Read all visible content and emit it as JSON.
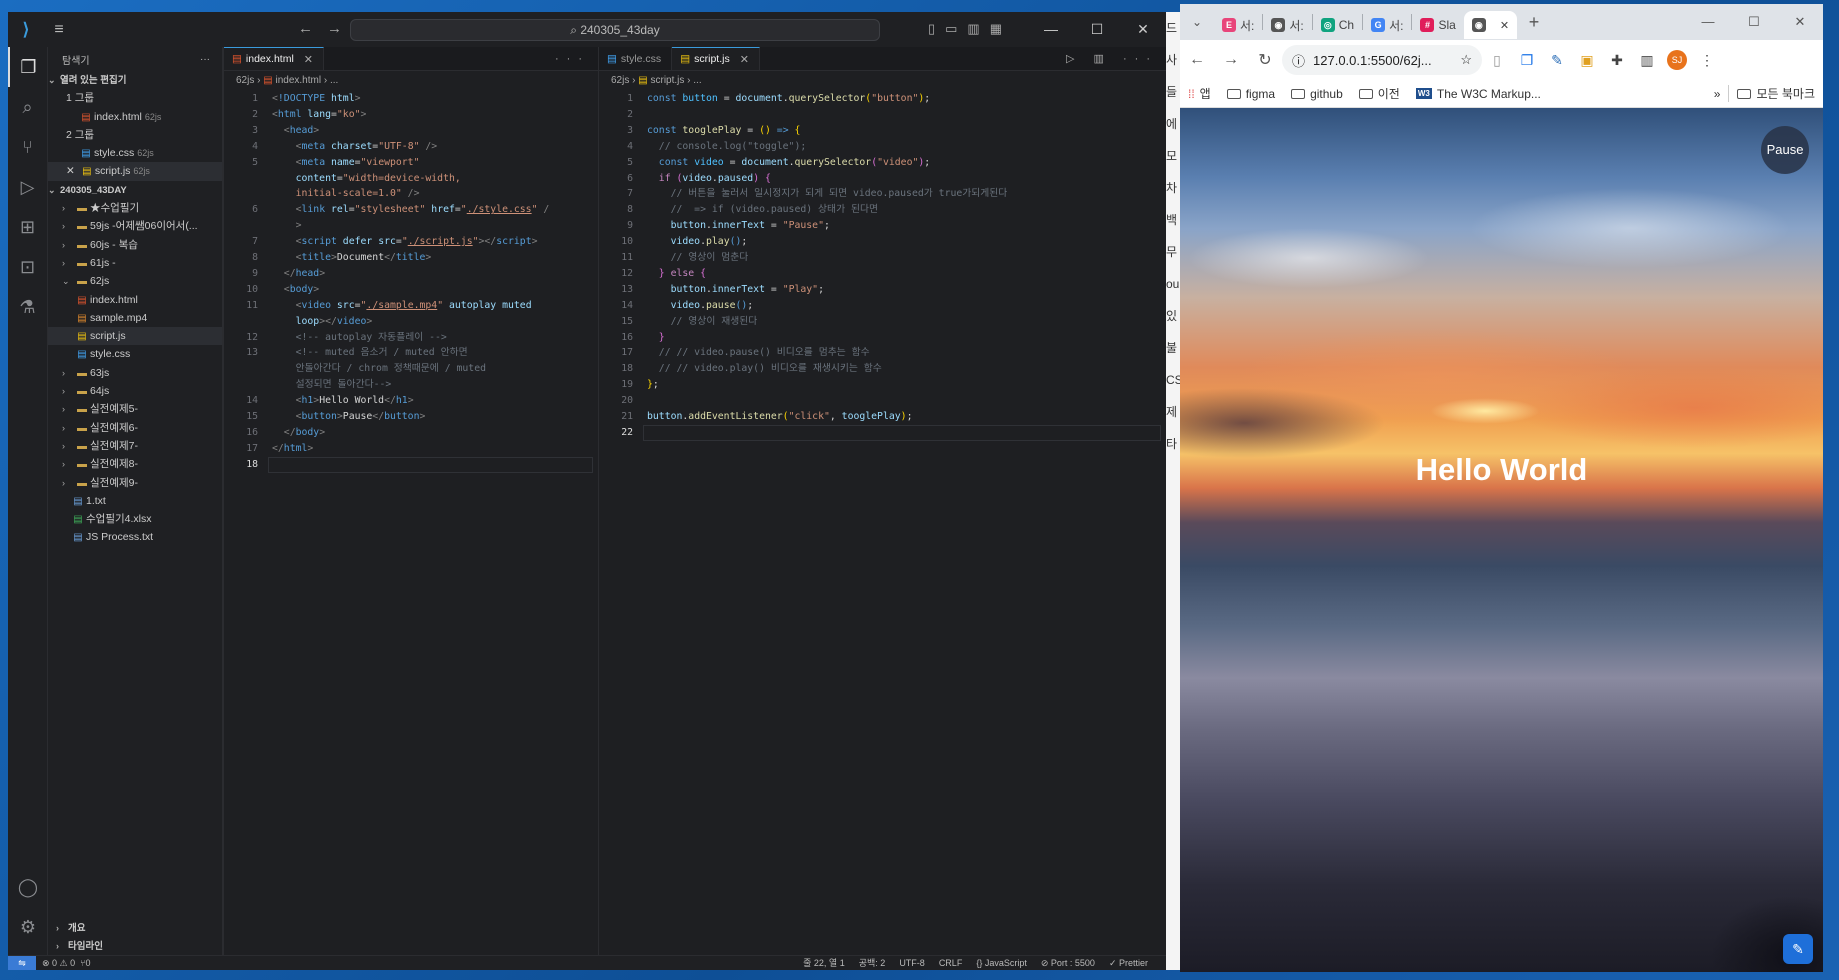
{
  "vscode": {
    "command_center": "240305_43day",
    "sidebar": {
      "title": "탐색기",
      "open_editors_title": "열려 있는 편집기",
      "group1": "1 그룹",
      "group2": "2 그룹",
      "open_files": [
        {
          "name": "index.html",
          "dir": "62js"
        },
        {
          "name": "style.css",
          "dir": "62js"
        },
        {
          "name": "script.js",
          "dir": "62js"
        }
      ],
      "project": "240305_43DAY",
      "tree_folders_top": [
        "★수업필기",
        "59js -어제쌤06이어서(...",
        "60js - 복습",
        "61js -"
      ],
      "open_folder": "62js",
      "open_folder_files": [
        "index.html",
        "sample.mp4",
        "script.js",
        "style.css"
      ],
      "tree_folders_bottom": [
        "63js",
        "64js",
        "실전예제5-",
        "실전예제6-",
        "실전예제7-",
        "실전예제8-",
        "실전예제9-"
      ],
      "root_files": [
        "1.txt",
        "수업필기4.xlsx",
        "JS Process.txt"
      ],
      "footer": [
        "개요",
        "타임라인"
      ]
    },
    "editor1": {
      "tab": "index.html",
      "crumbs": [
        "62js",
        "index.html",
        "..."
      ]
    },
    "editor2": {
      "tabs": [
        "style.css",
        "script.js"
      ],
      "crumbs": [
        "62js",
        "script.js",
        "..."
      ]
    },
    "statusbar": {
      "problems": "⊗ 0 ⚠ 0",
      "ports": "⑂0",
      "position": "줄 22, 열 1",
      "spaces": "공백: 2",
      "encoding": "UTF-8",
      "eol": "CRLF",
      "language": "{} JavaScript",
      "port": "⊘ Port : 5500",
      "prettier": "✓ Prettier"
    }
  },
  "chrome": {
    "tabs": [
      {
        "label": "서:",
        "favicon": "E",
        "color": "#e8457a"
      },
      {
        "label": "서:",
        "favicon": "◉",
        "color": "#555555"
      },
      {
        "label": "Ch",
        "favicon": "◎",
        "color": "#10a37f"
      },
      {
        "label": "서:",
        "favicon": "G",
        "color": "#4285f4"
      },
      {
        "label": "Sla",
        "favicon": "#",
        "color": "#e01e5a"
      },
      {
        "label": "",
        "favicon": "◉",
        "color": "#555555"
      }
    ],
    "url": "127.0.0.1:5500/62j...",
    "avatar": "SJ",
    "bookmarks": [
      "앱",
      "figma",
      "github",
      "이전",
      "The W3C Markup...",
      "»",
      "모든 북마크"
    ],
    "page": {
      "pause_label": "Pause",
      "heading": "Hello World"
    }
  },
  "background_strip": [
    "드",
    "사",
    "들",
    "에",
    "모",
    "차",
    "백",
    "무",
    "ou",
    "있",
    "불",
    "CS",
    "제",
    "타"
  ]
}
